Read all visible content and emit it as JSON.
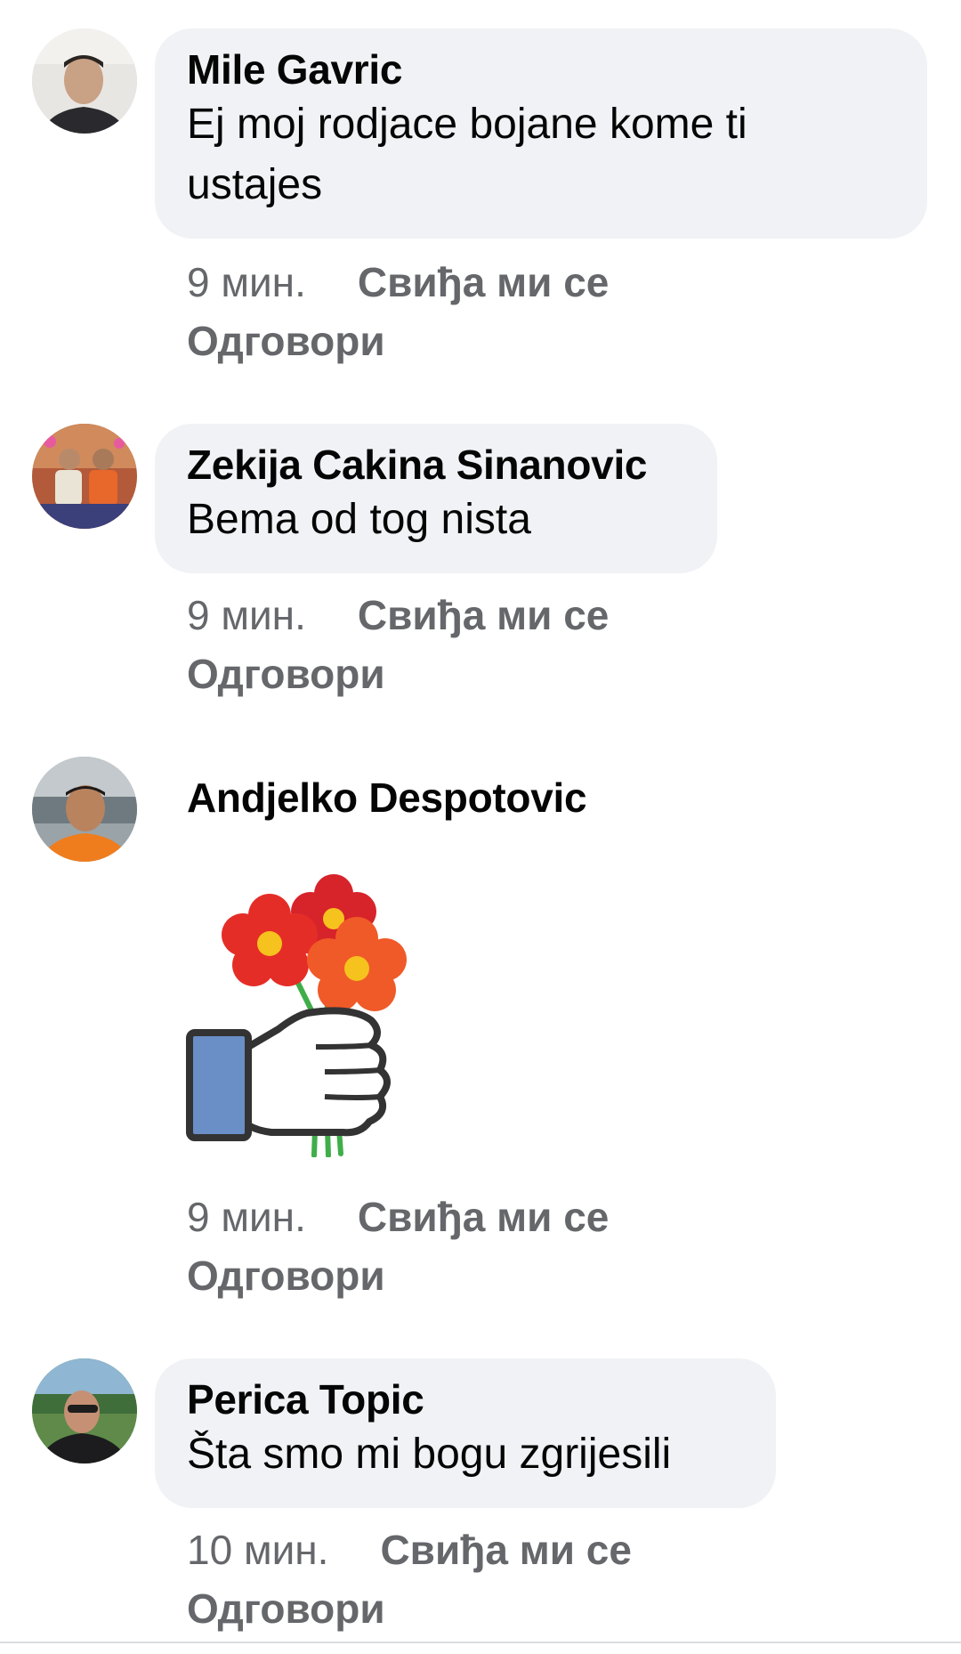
{
  "comments": [
    {
      "author": "Mile Gavric",
      "text_line1": "Ej moj rodjace bojane kome ti",
      "text_line2": "ustajes",
      "time": "9 мин.",
      "like": "Свиђа ми се",
      "reply": "Одговори"
    },
    {
      "author": "Zekija Cakina Sinanovic",
      "text_line1": "Bema od tog nista",
      "time": "9 мин.",
      "like": "Свиђа ми се",
      "reply": "Одговори"
    },
    {
      "author": "Andjelko Despotovic",
      "sticker": "like-hand-with-flowers-sticker",
      "time": "9 мин.",
      "like": "Свиђа ми се",
      "reply": "Одговори"
    },
    {
      "author": "Perica Topic",
      "text_line1": "Šta smo mi bogu zgrijesili",
      "time": "10 мин.",
      "like": "Свиђа ми се",
      "reply": "Одговори"
    }
  ],
  "colors": {
    "bubble": "#f0f2f5",
    "meta_text": "#65676b",
    "sticker_blue": "#6a8ec6"
  }
}
